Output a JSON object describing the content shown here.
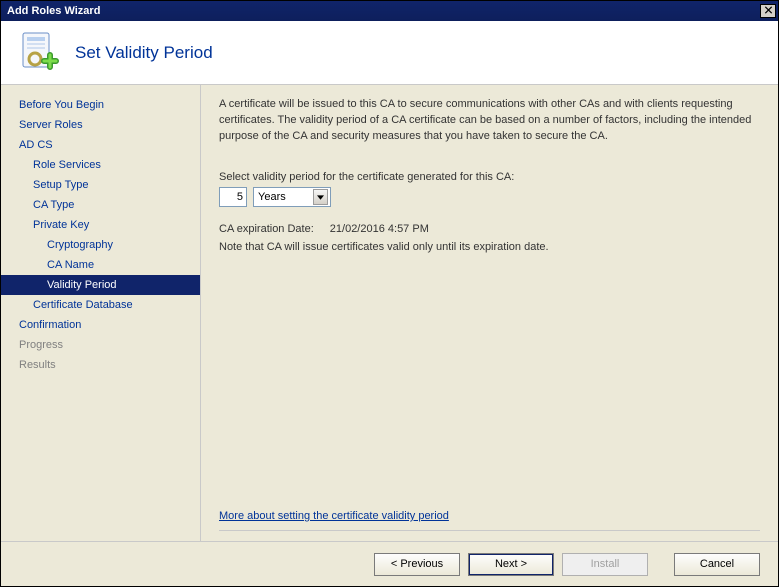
{
  "window": {
    "title": "Add Roles Wizard"
  },
  "header": {
    "title": "Set Validity Period"
  },
  "sidebar": {
    "items": [
      {
        "label": "Before You Begin"
      },
      {
        "label": "Server Roles"
      },
      {
        "label": "AD CS"
      },
      {
        "label": "Role Services"
      },
      {
        "label": "Setup Type"
      },
      {
        "label": "CA Type"
      },
      {
        "label": "Private Key"
      },
      {
        "label": "Cryptography"
      },
      {
        "label": "CA Name"
      },
      {
        "label": "Validity Period"
      },
      {
        "label": "Certificate Database"
      },
      {
        "label": "Confirmation"
      },
      {
        "label": "Progress"
      },
      {
        "label": "Results"
      }
    ]
  },
  "main": {
    "description": "A certificate will be issued to this CA to secure communications with other CAs and with clients requesting certificates. The validity period of a CA certificate can be based on a number of factors, including the intended purpose of the CA and security measures that you have taken to secure the CA.",
    "prompt": "Select validity period for the certificate generated for this CA:",
    "value": "5",
    "unit": "Years",
    "expiration_label": "CA expiration Date:",
    "expiration_value": "21/02/2016 4:57 PM",
    "note": "Note that CA will issue certificates valid only until its expiration date.",
    "link": "More about setting the certificate validity period"
  },
  "footer": {
    "previous": "< Previous",
    "next": "Next >",
    "install": "Install",
    "cancel": "Cancel"
  }
}
